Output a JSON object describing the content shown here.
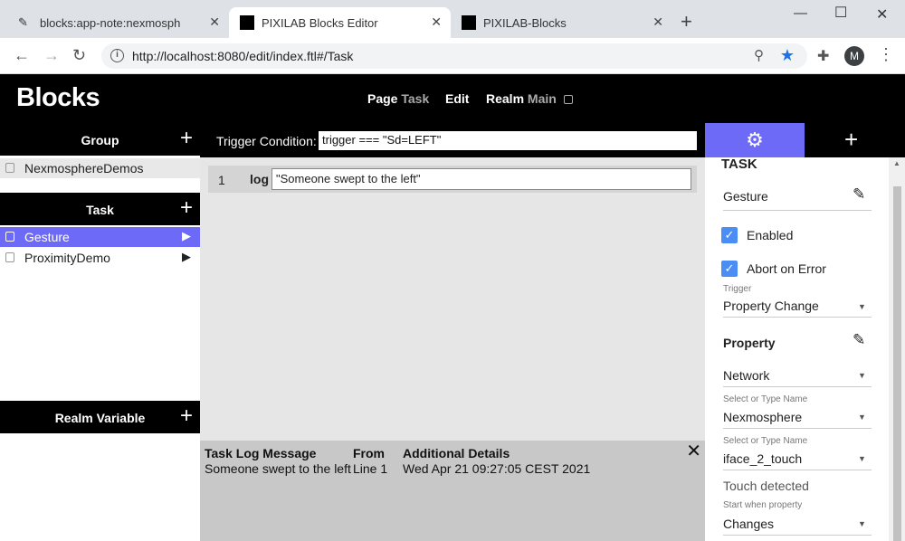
{
  "browser": {
    "tabs": [
      {
        "title": "blocks:app-note:nexmospher"
      },
      {
        "title": "PIXILAB Blocks Editor"
      },
      {
        "title": "PIXILAB-Blocks"
      }
    ],
    "url": "http://localhost:8080/edit/index.ftl#/Task",
    "avatar_letter": "M"
  },
  "app": {
    "logo": "Blocks",
    "nav": {
      "page_label": "Page",
      "page_value": "Task",
      "edit_label": "Edit",
      "realm_label": "Realm",
      "realm_value": "Main"
    }
  },
  "sidebar": {
    "group_header": "Group",
    "groups": [
      {
        "label": "NexmosphereDemos"
      }
    ],
    "task_header": "Task",
    "tasks": [
      {
        "label": "Gesture",
        "selected": true
      },
      {
        "label": "ProximityDemo",
        "selected": false
      }
    ],
    "realm_variable_header": "Realm Variable"
  },
  "main": {
    "trigger_label": "Trigger Condition:",
    "trigger_value": "trigger === \"Sd=LEFT\"",
    "statement": {
      "line_number": "1",
      "keyword": "log",
      "value": "\"Someone swept to the left\""
    }
  },
  "log": {
    "headers": {
      "message": "Task Log Message",
      "from": "From",
      "details": "Additional Details"
    },
    "row": {
      "message": "Someone swept to the left",
      "from": "Line 1",
      "details": "Wed Apr 21 09:27:05 CEST 2021"
    }
  },
  "properties": {
    "section_title": "TASK",
    "task_name": "Gesture",
    "enabled_label": "Enabled",
    "abort_label": "Abort on Error",
    "trigger_caption": "Trigger",
    "trigger_value": "Property Change",
    "property_header": "Property",
    "network_value": "Network",
    "select_caption_1": "Select or Type Name",
    "nexmosphere_value": "Nexmosphere",
    "select_caption_2": "Select or Type Name",
    "iface_value": "iface_2_touch",
    "touch_label": "Touch detected",
    "start_caption": "Start when property",
    "changes_value": "Changes"
  },
  "colors": {
    "accent": "#6e6af8",
    "checkbox": "#4a8df5",
    "chrome_tabbar": "#dee1e6"
  }
}
